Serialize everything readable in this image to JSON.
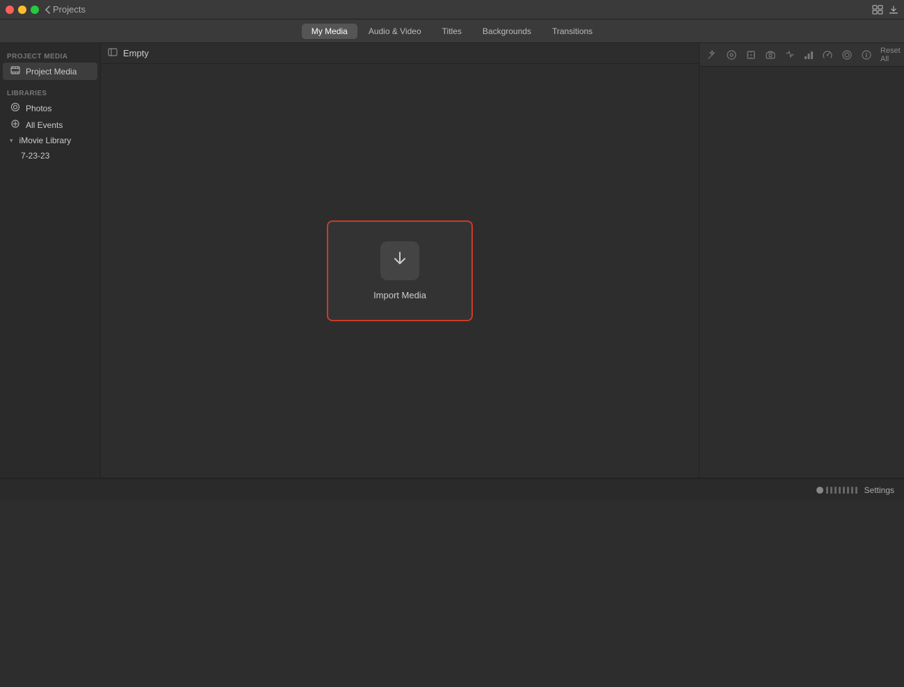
{
  "titlebar": {
    "back_label": "Projects",
    "traffic_lights": [
      "close",
      "minimize",
      "maximize"
    ],
    "icons_right": [
      "grid-view-icon",
      "download-icon"
    ]
  },
  "tabs": {
    "items": [
      {
        "id": "my-media",
        "label": "My Media",
        "active": true
      },
      {
        "id": "audio-video",
        "label": "Audio & Video",
        "active": false
      },
      {
        "id": "titles",
        "label": "Titles",
        "active": false
      },
      {
        "id": "backgrounds",
        "label": "Backgrounds",
        "active": false
      },
      {
        "id": "transitions",
        "label": "Transitions",
        "active": false
      }
    ]
  },
  "sidebar": {
    "project_media_label": "PROJECT MEDIA",
    "project_media_item": "Project Media",
    "libraries_label": "LIBRARIES",
    "library_items": [
      {
        "label": "Photos",
        "icon": "photos"
      },
      {
        "label": "All Events",
        "icon": "plus"
      },
      {
        "label": "iMovie Library",
        "icon": "chevron",
        "expanded": true
      },
      {
        "label": "7-23-23",
        "icon": "",
        "sub": true
      }
    ]
  },
  "media_area": {
    "header_title": "Empty",
    "import_label": "Import Media"
  },
  "inspector": {
    "reset_label": "Reset All",
    "icons": [
      "magic-wand",
      "color-wheel",
      "crop",
      "camera",
      "audio",
      "bars",
      "speed",
      "filter",
      "info"
    ]
  },
  "timeline": {
    "settings_label": "Settings"
  }
}
